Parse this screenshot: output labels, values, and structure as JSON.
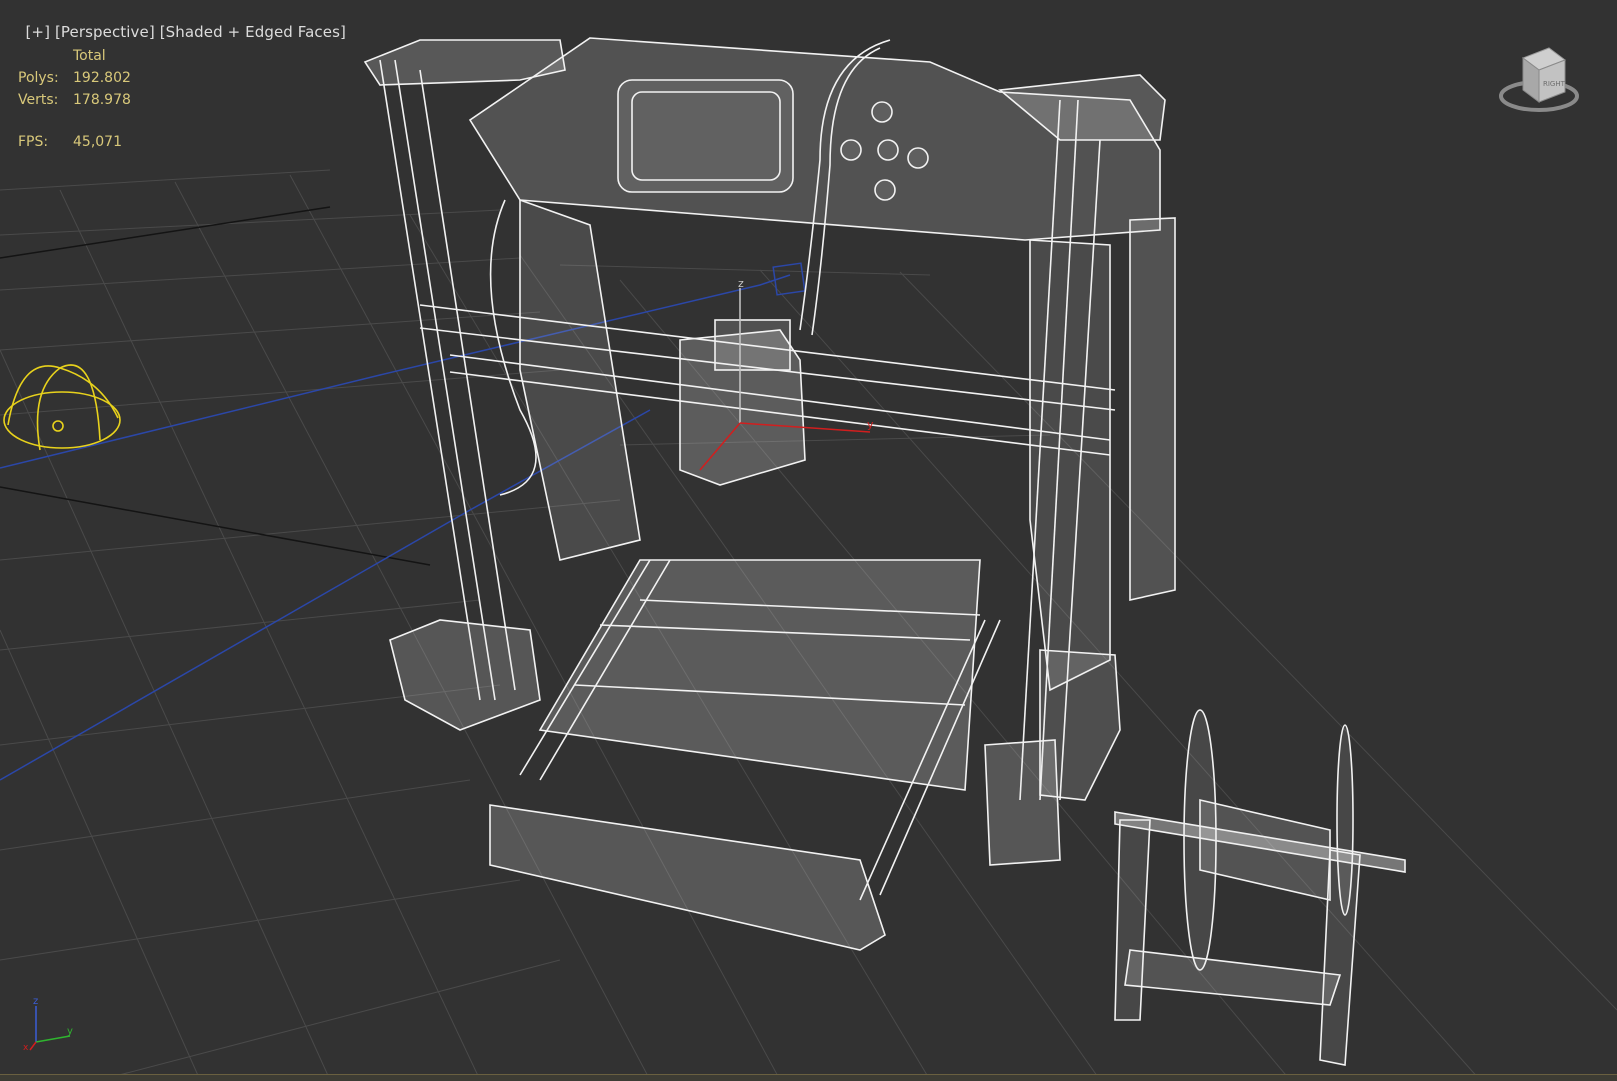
{
  "viewport": {
    "menu_plus": "[+]",
    "menu_view": "[Perspective]",
    "menu_shading": "[Shaded + Edged Faces]"
  },
  "stats": {
    "total_label": "Total",
    "polys_label": "Polys:",
    "polys_value": "192.802",
    "verts_label": "Verts:",
    "verts_value": "178.978",
    "fps_label": "FPS:",
    "fps_value": "45,071"
  },
  "viewcube": {
    "face_label": "RIGHT"
  },
  "axis": {
    "x": "x",
    "y": "y",
    "z": "z"
  },
  "colors": {
    "background": "#323232",
    "grid": "#4a4a4a",
    "wire": "#f2f2f2",
    "stats_text": "#d8c87a",
    "light_gizmo": "#e8d21c",
    "camera_line": "#2b47a8"
  }
}
